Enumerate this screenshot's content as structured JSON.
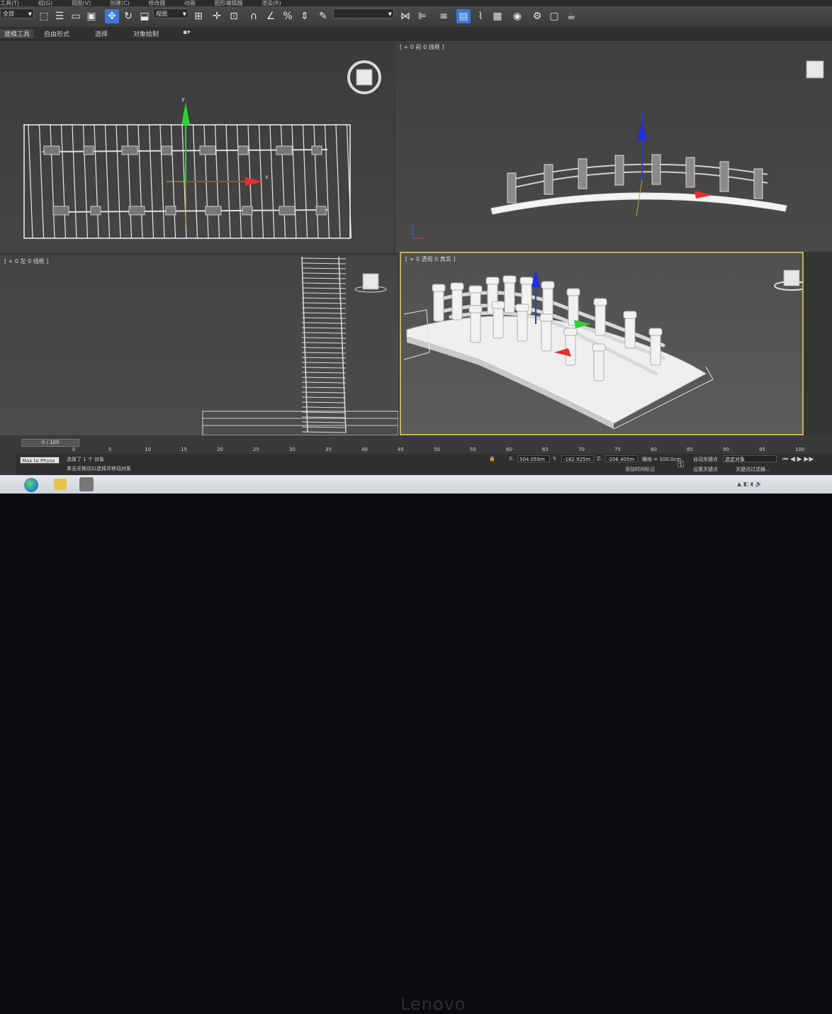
{
  "menu": [
    "工具(T)",
    "组(G)",
    "视图(V)",
    "创建(C)",
    "修改器",
    "动画",
    "图形编辑器",
    "渲染(R)"
  ],
  "toolbar": {
    "selection_filter": "全部",
    "ref_coord": "视图",
    "named_selection": ""
  },
  "ribbon": {
    "tabs": [
      "建模工具",
      "自由形式",
      "选择",
      "对象绘制"
    ]
  },
  "viewports": {
    "top_label": "",
    "front_label": "[ + 0 前 0 线框 ]",
    "left_label": "[ + 0 左 0 线框 ]",
    "persp_label": "[ + 0 透视 0 真实 ]"
  },
  "axes": {
    "y": "y",
    "x": "x"
  },
  "timeline": {
    "frame": "0 / 100",
    "ticks": [
      "0",
      "5",
      "10",
      "15",
      "20",
      "25",
      "30",
      "35",
      "40",
      "45",
      "50",
      "55",
      "60",
      "65",
      "70",
      "75",
      "80",
      "85",
      "90",
      "95",
      "100"
    ]
  },
  "status": {
    "script_label": "Max to Physx",
    "selected": "选择了 1 个 对象",
    "hint": "单击并拖动以选择并移动对象",
    "x_value": "504.059m",
    "y_value": "-162.925m",
    "z_value": "-206.405m",
    "grid": "栅格 = 100.0cm",
    "add_time_tag": "添加时间标记",
    "auto_key": "自动关键点",
    "set_key": "设置关键点",
    "selected_obj": "选定对象",
    "key_filters": "关键点过滤器..."
  },
  "brand": "Lenovo",
  "colors": {
    "accent": "#3a78d6",
    "active_viewport": "#c9b14a"
  }
}
